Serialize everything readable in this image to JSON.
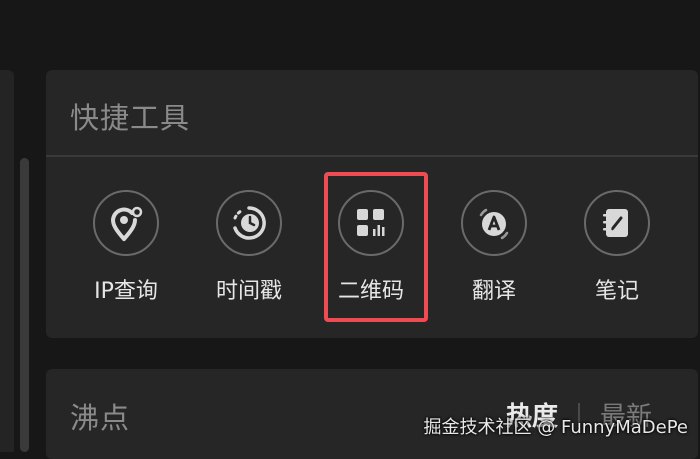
{
  "tools_panel": {
    "title": "快捷工具",
    "tools": [
      {
        "label": "IP查询",
        "icon": "ip-location-icon"
      },
      {
        "label": "时间戳",
        "icon": "timestamp-clock-icon"
      },
      {
        "label": "二维码",
        "icon": "qr-code-icon"
      },
      {
        "label": "翻译",
        "icon": "translate-icon"
      },
      {
        "label": "笔记",
        "icon": "notebook-icon"
      }
    ],
    "selected_tool": "二维码",
    "highlight_color": "#ef4b52"
  },
  "feed_panel": {
    "title": "沸点",
    "tabs": [
      {
        "label": "热度",
        "active": true
      },
      {
        "label": "最新",
        "active": false
      }
    ]
  },
  "watermark": "掘金技术社区 @ FunnyMaDePe"
}
